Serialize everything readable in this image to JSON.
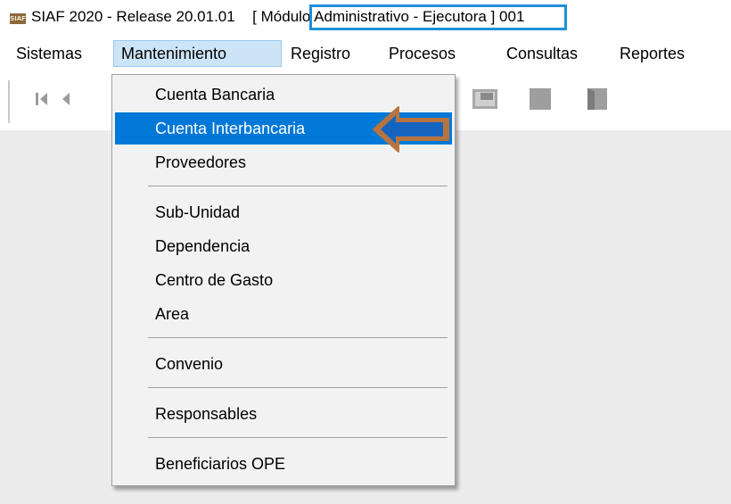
{
  "titlebar": {
    "app_icon_text": "SIAF",
    "title_prefix": "SIAF 2020 - Release 20.01.01",
    "title_highlighted": "[ Módulo Administrativo -",
    "title_suffix": "Ejecutora ] 001"
  },
  "menubar": {
    "items": [
      "Sistemas",
      "Mantenimiento",
      "Registro",
      "Procesos",
      "Consultas",
      "Reportes"
    ],
    "active": "Mantenimiento"
  },
  "toolbar": {
    "buttons": [
      "first-record-icon",
      "previous-record-icon",
      "grid-icon",
      "square-icon",
      "door-icon"
    ]
  },
  "dropdown": {
    "items": [
      "Cuenta Bancaria",
      "Cuenta Interbancaria",
      "Proveedores",
      "Sub-Unidad",
      "Dependencia",
      "Centro de Gasto",
      "Area",
      "Convenio",
      "Responsables",
      "Beneficiarios OPE"
    ],
    "selected": "Cuenta Interbancaria"
  },
  "colors": {
    "selection": "#0078d7",
    "title_highlight_border": "#1e90d8",
    "arrow_fill": "#1565c0",
    "arrow_outline": "#b8743f"
  }
}
